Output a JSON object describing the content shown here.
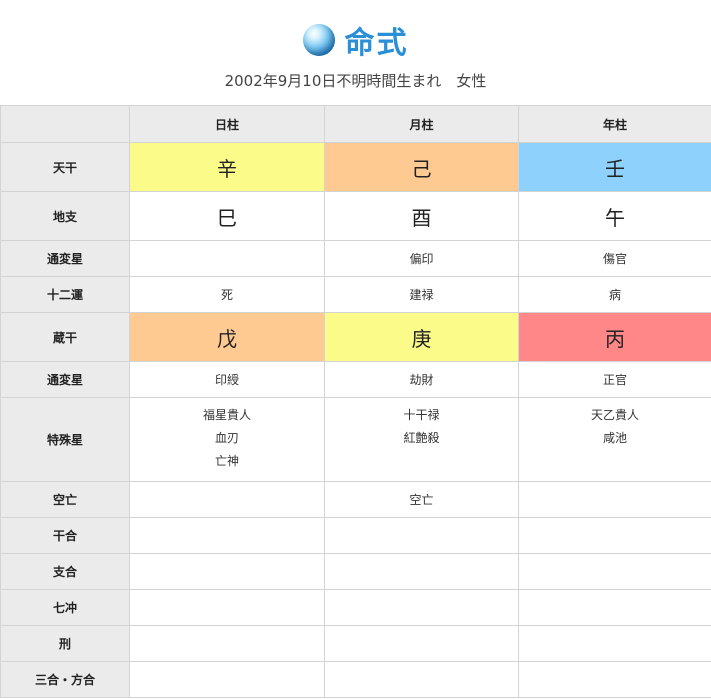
{
  "header": {
    "title": "命式",
    "subtitle": "2002年9月10日不明時間生まれ　女性"
  },
  "columns": [
    "日柱",
    "月柱",
    "年柱"
  ],
  "rows": {
    "tenkan": {
      "label": "天干",
      "cells": [
        "辛",
        "己",
        "壬"
      ],
      "colors": [
        "#fbfb8a",
        "#ffc992",
        "#8dd1fc"
      ]
    },
    "chishi": {
      "label": "地支",
      "cells": [
        "巳",
        "酉",
        "午"
      ]
    },
    "tsuhen1": {
      "label": "通変星",
      "cells": [
        "",
        "偏印",
        "傷官"
      ]
    },
    "juniun": {
      "label": "十二運",
      "cells": [
        "死",
        "建禄",
        "病"
      ]
    },
    "zoukan": {
      "label": "蔵干",
      "cells": [
        "戊",
        "庚",
        "丙"
      ],
      "colors": [
        "#ffc992",
        "#fbfb8a",
        "#ff8787"
      ]
    },
    "tsuhen2": {
      "label": "通変星",
      "cells": [
        "印綬",
        "劫財",
        "正官"
      ]
    },
    "tokushu": {
      "label": "特殊星",
      "cells": [
        [
          "福星貴人",
          "血刃",
          "亡神"
        ],
        [
          "十干禄",
          "紅艶殺"
        ],
        [
          "天乙貴人",
          "咸池"
        ]
      ]
    },
    "kubo": {
      "label": "空亡",
      "cells": [
        "",
        "空亡",
        ""
      ]
    },
    "kango": {
      "label": "干合",
      "cells": [
        "",
        "",
        ""
      ]
    },
    "shigo": {
      "label": "支合",
      "cells": [
        "",
        "",
        ""
      ]
    },
    "shichichu": {
      "label": "七冲",
      "cells": [
        "",
        "",
        ""
      ]
    },
    "kei": {
      "label": "刑",
      "cells": [
        "",
        "",
        ""
      ]
    },
    "sango": {
      "label": "三合・方合",
      "cells": [
        "",
        "",
        ""
      ]
    }
  }
}
